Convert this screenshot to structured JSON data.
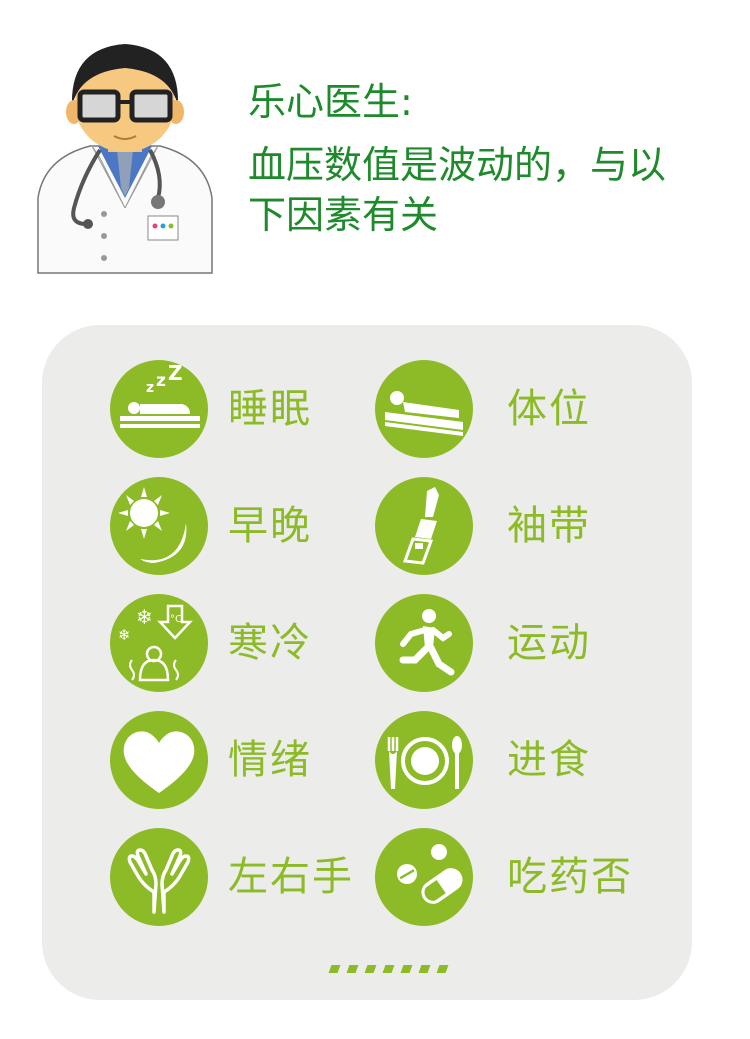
{
  "header": {
    "doctor_name": "乐心医生:",
    "message": "血压数值是波动的，与以下因素有关"
  },
  "factors": [
    {
      "label": "睡眠",
      "icon": "sleep-icon"
    },
    {
      "label": "体位",
      "icon": "body-position-icon"
    },
    {
      "label": "早晚",
      "icon": "sun-moon-icon"
    },
    {
      "label": "袖带",
      "icon": "cuff-arm-icon"
    },
    {
      "label": "寒冷",
      "icon": "cold-icon"
    },
    {
      "label": "运动",
      "icon": "running-icon"
    },
    {
      "label": "情绪",
      "icon": "heart-icon"
    },
    {
      "label": "进食",
      "icon": "dining-icon"
    },
    {
      "label": "左右手",
      "icon": "hands-icon"
    },
    {
      "label": "吃药否",
      "icon": "pills-icon"
    }
  ],
  "colors": {
    "accent": "#8dbb27",
    "heading": "#1e8a2c",
    "panel": "#ececea"
  }
}
